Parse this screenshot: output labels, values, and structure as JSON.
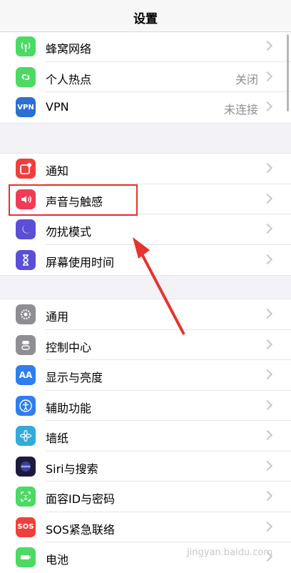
{
  "nav": {
    "title": "设置"
  },
  "groups": [
    {
      "rows": [
        {
          "label": "蜂窝网络",
          "value": "",
          "icon": "antenna-icon",
          "color": "#4cd964"
        },
        {
          "label": "个人热点",
          "value": "关闭",
          "icon": "hotspot-link-icon",
          "color": "#4cd964"
        },
        {
          "label": "VPN",
          "value": "未连接",
          "icon": "vpn-icon",
          "color": "#2b6fd6"
        }
      ]
    },
    {
      "rows": [
        {
          "label": "通知",
          "value": "",
          "icon": "notification-icon",
          "color": "#f23e3a"
        },
        {
          "label": "声音与触感",
          "value": "",
          "icon": "speaker-icon",
          "color": "#f23a57"
        },
        {
          "label": "勿扰模式",
          "value": "",
          "icon": "moon-icon",
          "color": "#5b4fd6"
        },
        {
          "label": "屏幕使用时间",
          "value": "",
          "icon": "hourglass-icon",
          "color": "#5b4fd6"
        }
      ]
    },
    {
      "rows": [
        {
          "label": "通用",
          "value": "",
          "icon": "gear-icon",
          "color": "#8e8e93"
        },
        {
          "label": "控制中心",
          "value": "",
          "icon": "toggles-icon",
          "color": "#8e8e93"
        },
        {
          "label": "显示与亮度",
          "value": "",
          "icon": "text-size-icon",
          "color": "#2f7ef0"
        },
        {
          "label": "辅助功能",
          "value": "",
          "icon": "accessibility-icon",
          "color": "#2f7ef0"
        },
        {
          "label": "墙纸",
          "value": "",
          "icon": "flower-icon",
          "color": "#34aadc"
        },
        {
          "label": "Siri与搜索",
          "value": "",
          "icon": "siri-icon",
          "color": "#1c1c3a"
        },
        {
          "label": "面容ID与密码",
          "value": "",
          "icon": "face-id-icon",
          "color": "#4cd964"
        },
        {
          "label": "SOS紧急联络",
          "value": "",
          "icon": "sos-icon",
          "color": "#f23e3a"
        },
        {
          "label": "电池",
          "value": "",
          "icon": "battery-icon",
          "color": "#4cd964"
        }
      ]
    }
  ],
  "vpn_text": "VPN",
  "sos_text": "SOS",
  "aa_text": "AA",
  "watermark": "jingyan.baidu.com"
}
